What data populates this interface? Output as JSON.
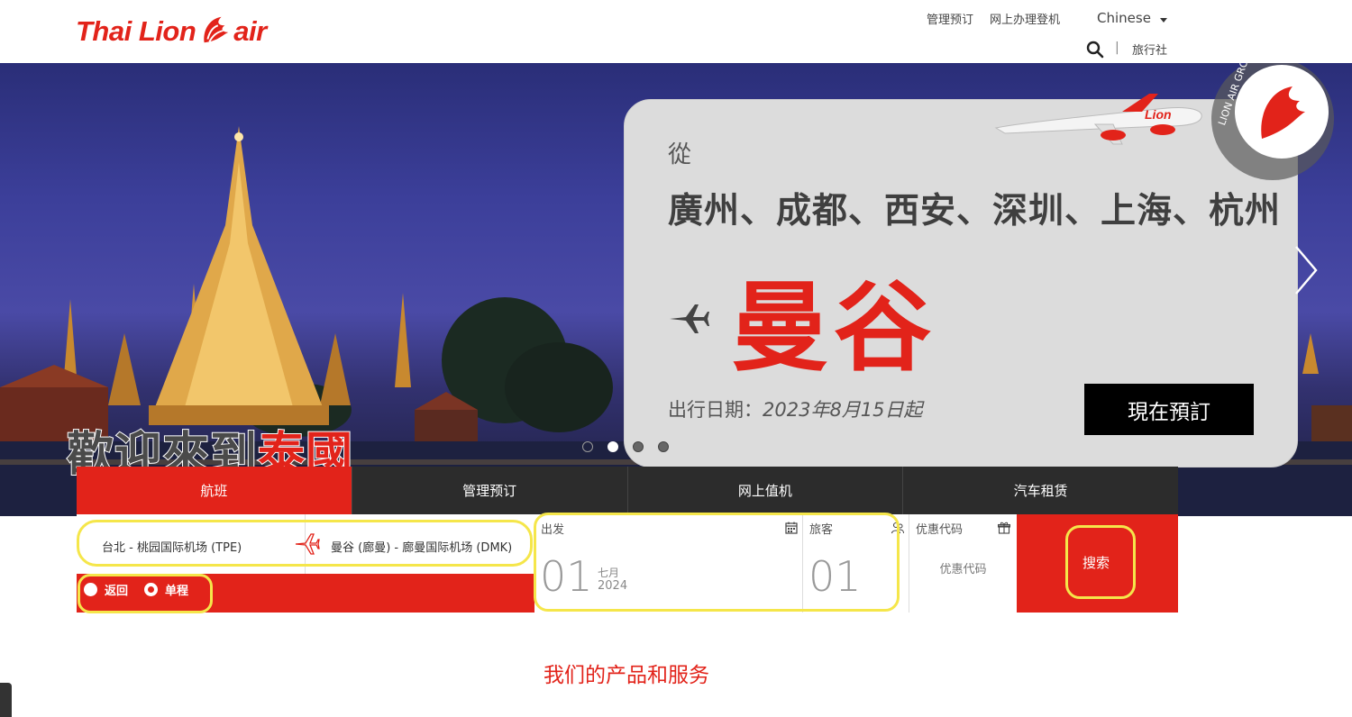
{
  "header": {
    "logo": {
      "left": "Thai Lion",
      "right": "air"
    },
    "nav": [
      "管理预订",
      "网上办理登机"
    ],
    "language": "Chinese",
    "agency": "旅行社"
  },
  "hero": {
    "welcome_part1": "歡迎來到",
    "welcome_part2": "泰國",
    "promo": {
      "from": "從",
      "cities": "廣州、成都、西安、深圳、上海、杭州",
      "destination": "曼谷",
      "date_label": "出行日期：",
      "date_value": "2023年8月15日起",
      "cta": "現在預訂"
    },
    "slides": 4,
    "active_slide": 2
  },
  "tabs": [
    {
      "label": "航班",
      "active": true
    },
    {
      "label": "管理预订",
      "active": false
    },
    {
      "label": "网上值机",
      "active": false
    },
    {
      "label": "汽车租赁",
      "active": false
    }
  ],
  "booking": {
    "origin": "台北 - 桃园国际机场 (TPE)",
    "destination": "曼谷 (廊曼) - 廊曼国际机场 (DMK)",
    "trip_return": "返回",
    "trip_oneway": "单程",
    "depart_label": "出发",
    "depart_day": "01",
    "depart_month": "七月",
    "depart_year": "2024",
    "pax_label": "旅客",
    "pax_count": "01",
    "promo_label": "优惠代码",
    "promo_placeholder": "优惠代码",
    "search": "搜索"
  },
  "section_title": "我们的产品和服务",
  "colors": {
    "brand_red": "#e2231a",
    "tab_dark": "#2c2c2c",
    "highlight": "#f5e64a"
  }
}
